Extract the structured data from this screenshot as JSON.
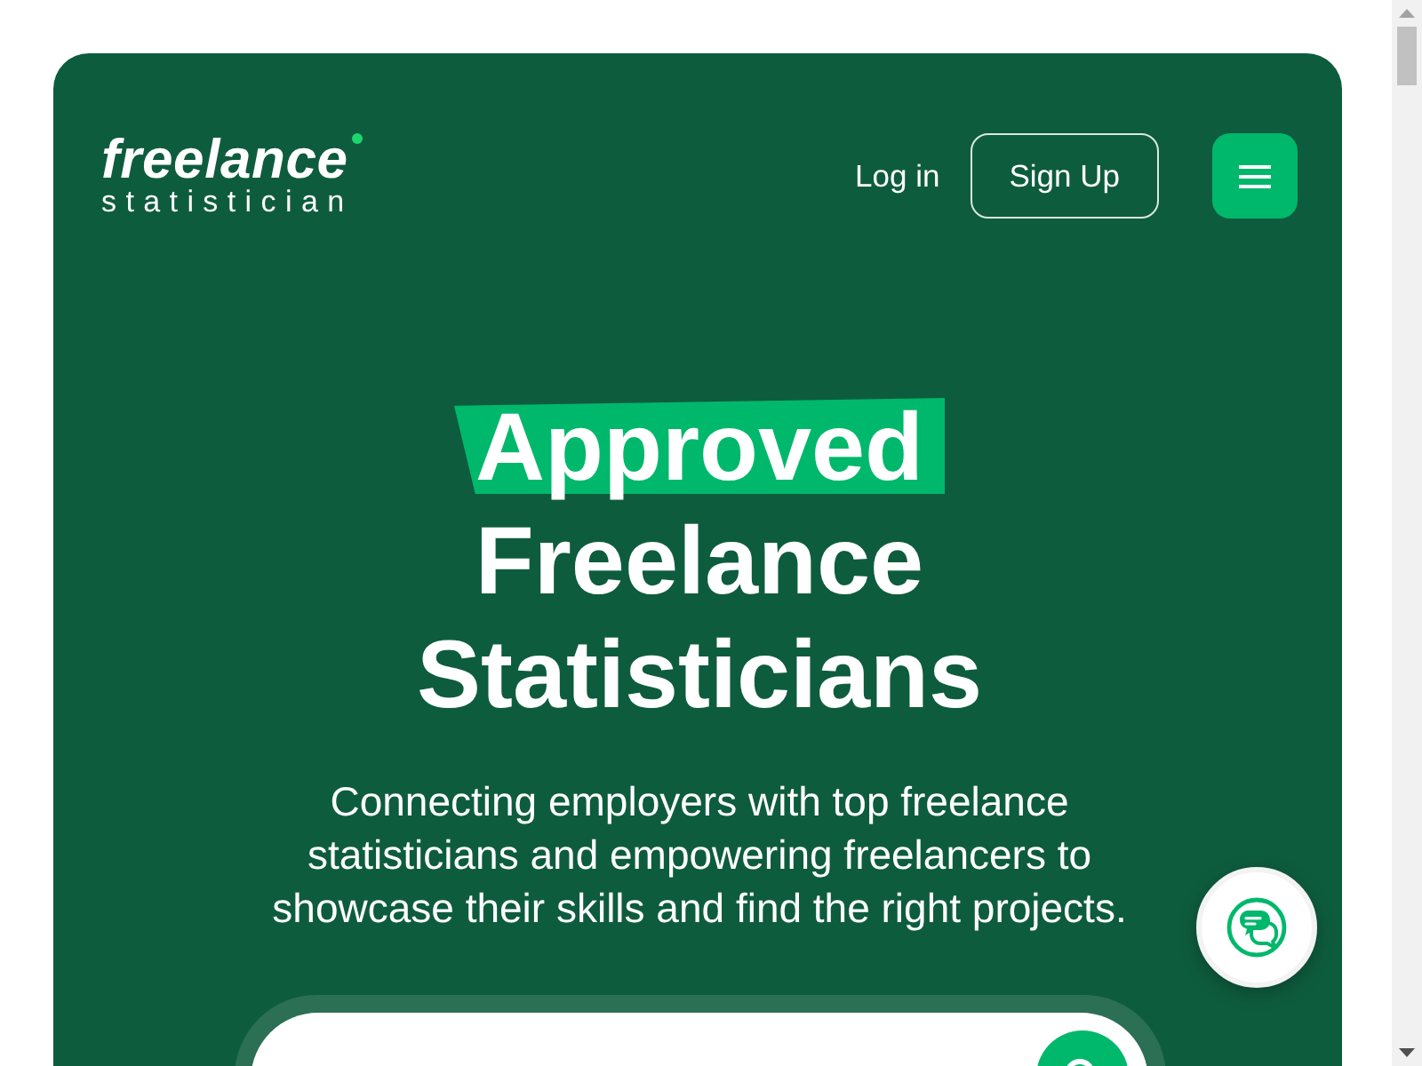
{
  "logo": {
    "wordmark": "freelance",
    "tagline": "statistician"
  },
  "nav": {
    "login": "Log in",
    "signup": "Sign Up"
  },
  "hero": {
    "heading_highlight": "Approved",
    "heading_rest": "Freelance Statisticians",
    "description": "Connecting employers with top freelance statisticians and empowering freelancers to showcase their skills and find the right projects."
  }
}
